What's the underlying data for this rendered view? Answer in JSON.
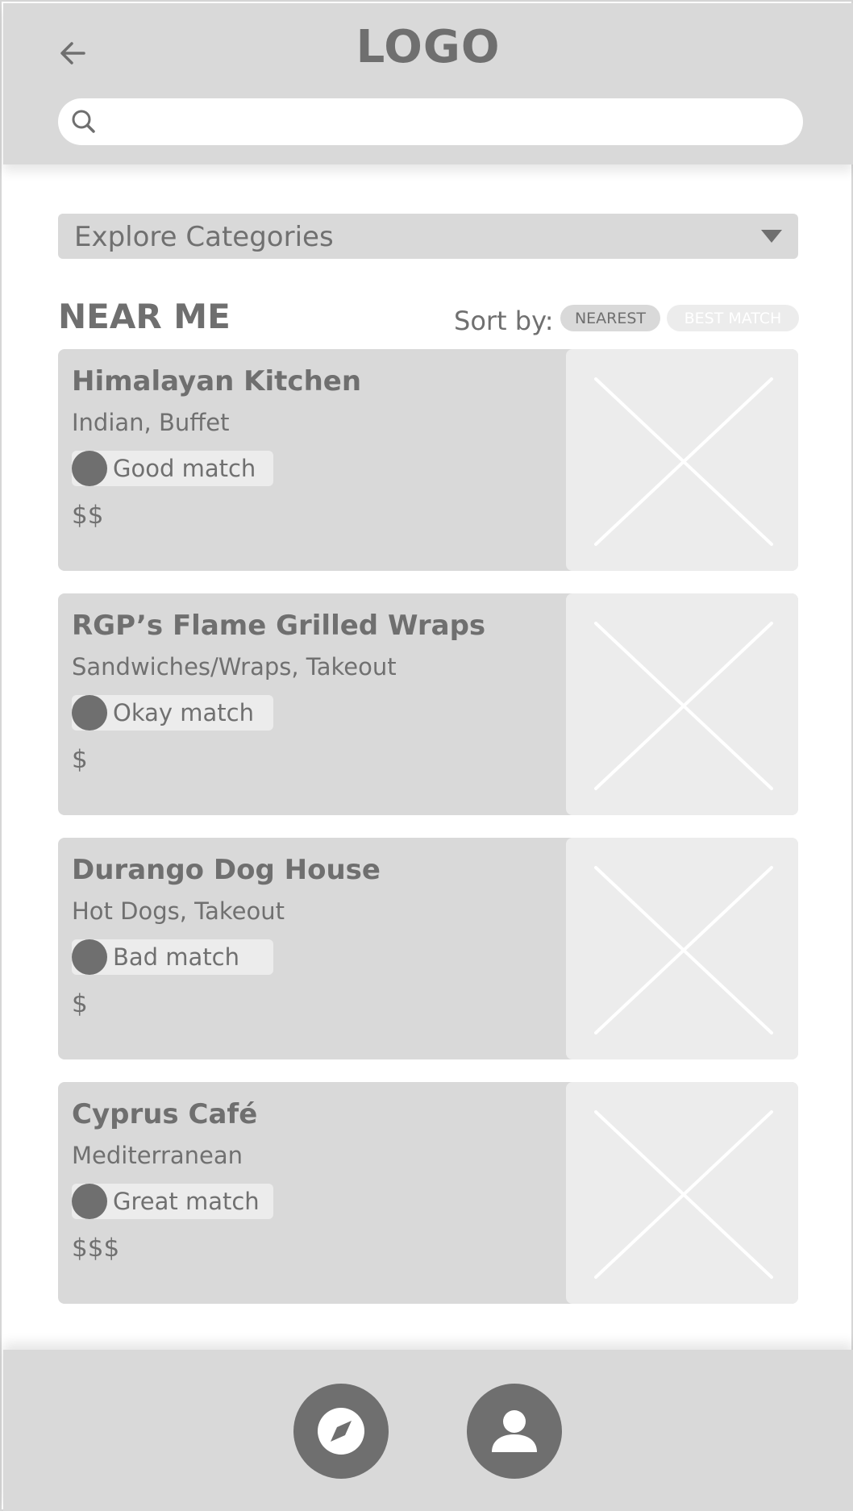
{
  "header": {
    "logo": "LOGO",
    "back_icon": "arrow-left-icon",
    "search": {
      "icon": "search-icon",
      "value": "",
      "placeholder": ""
    }
  },
  "categories": {
    "label": "Explore Categories",
    "icon": "caret-down-icon"
  },
  "near_me": {
    "title": "NEAR ME",
    "sort_label": "Sort by:",
    "sort_options": [
      {
        "label": "NEAREST",
        "selected": true
      },
      {
        "label": "BEST MATCH",
        "selected": false
      }
    ]
  },
  "restaurants": [
    {
      "name": "Himalayan Kitchen",
      "cuisine": "Indian, Buffet",
      "match": "Good match",
      "price": "$$"
    },
    {
      "name": "RGP’s Flame Grilled Wraps",
      "cuisine": "Sandwiches/Wraps, Takeout",
      "match": "Okay match",
      "price": "$"
    },
    {
      "name": "Durango Dog House",
      "cuisine": "Hot Dogs, Takeout",
      "match": "Bad match",
      "price": "$"
    },
    {
      "name": "Cyprus Café",
      "cuisine": "Mediterranean",
      "match": "Great match",
      "price": "$$$"
    }
  ],
  "bottom_nav": [
    {
      "icon": "compass-icon",
      "name": "explore"
    },
    {
      "icon": "user-icon",
      "name": "profile"
    }
  ],
  "colors": {
    "panel": "#d9d9d9",
    "dark": "#6f6f6f",
    "light": "#ececec",
    "background": "#ffffff"
  }
}
